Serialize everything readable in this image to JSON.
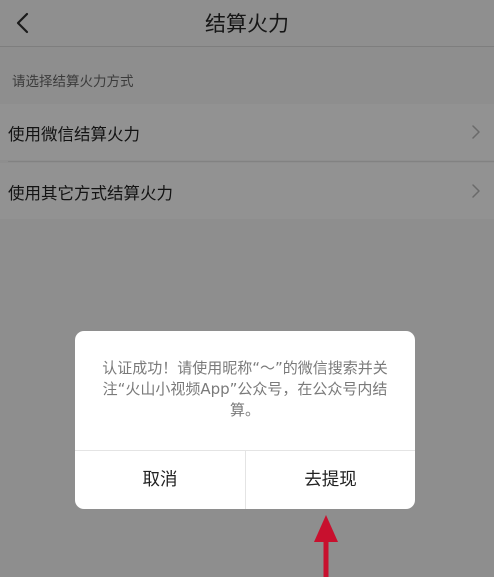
{
  "header": {
    "title": "结算火力"
  },
  "section": {
    "hint": "请选择结算火力方式"
  },
  "options": [
    {
      "label": "使用微信结算火力"
    },
    {
      "label": "使用其它方式结算火力"
    }
  ],
  "dialog": {
    "message": "认证成功！请使用昵称“～”的微信搜索并关注“火山小视频App”公众号，在公众号内结算。",
    "cancel_label": "取消",
    "confirm_label": "去提现"
  },
  "annotation": {
    "arrow_color": "#c8102e"
  },
  "icons": {
    "back": "back-chevron-icon",
    "option_chevron": "chevron-right-icon",
    "annotation_arrow": "up-arrow-icon"
  }
}
